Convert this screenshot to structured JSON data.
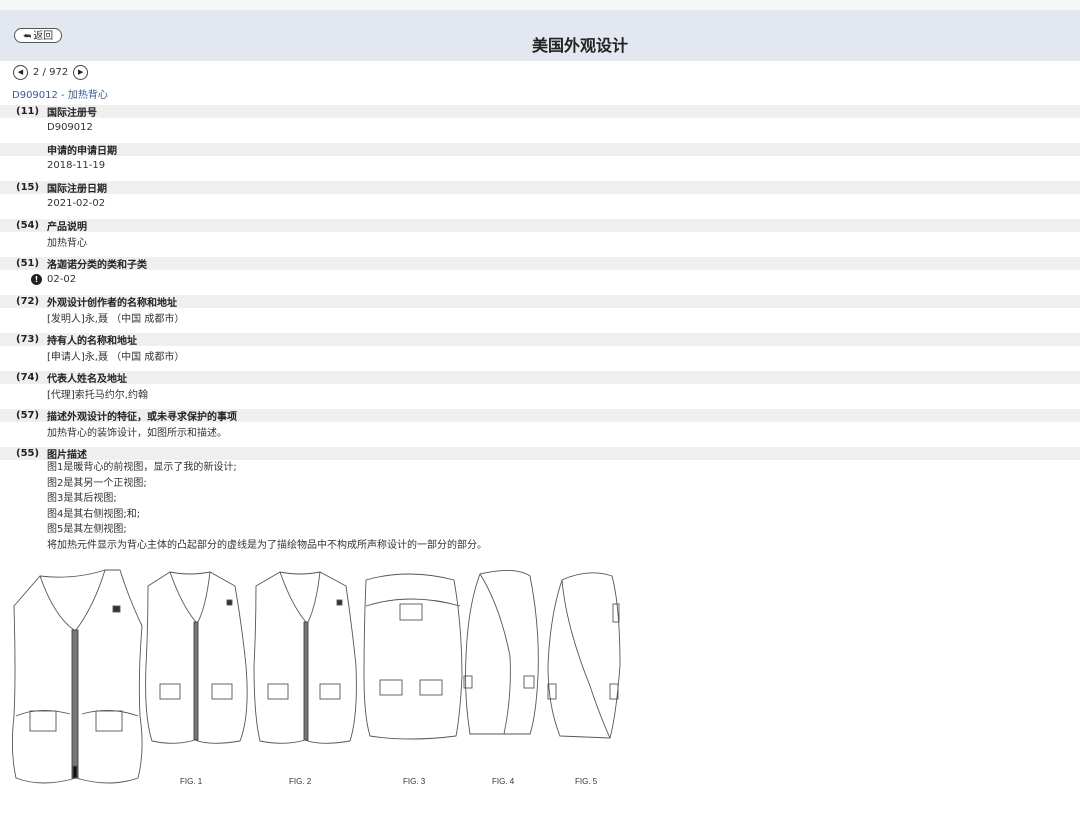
{
  "header": {
    "back_label": "返回",
    "title": "美国外观设计"
  },
  "pager": {
    "prev_icon": "chevron-left-icon",
    "current": "2 / 972",
    "next_icon": "chevron-right-icon"
  },
  "record_title": "D909012 - 加热背心",
  "fields": [
    {
      "code": "(11)",
      "label": "国际注册号",
      "value": "D909012"
    },
    {
      "code": "",
      "label": "申请的申请日期",
      "value": "2018-11-19"
    },
    {
      "code": "(15)",
      "label": "国际注册日期",
      "value": "2021-02-02"
    },
    {
      "code": "(54)",
      "label": "产品说明",
      "value": "加热背心"
    },
    {
      "code": "(51)",
      "label": "洛迦诺分类的类和子类",
      "value": "02-02"
    },
    {
      "code": "(72)",
      "label": "外观设计创作者的名称和地址",
      "value": "[发明人]永,聂 （中国 成都市）"
    },
    {
      "code": "(73)",
      "label": "持有人的名称和地址",
      "value": "[申请人]永,聂 （中国 成都市）"
    },
    {
      "code": "(74)",
      "label": "代表人姓名及地址",
      "value": "[代理]索托马约尔,约翰"
    },
    {
      "code": "(57)",
      "label": "描述外观设计的特征，或未寻求保护的事项",
      "value": "加热背心的装饰设计，如图所示和描述。"
    },
    {
      "code": "(55)",
      "label": "图片描述"
    }
  ],
  "figure_description": [
    "图1是暖背心的前视图，显示了我的新设计;",
    "图2是其另一个正视图;",
    "图3是其后视图;",
    "图4是其右侧视图;和;",
    "图5是其左侧视图;",
    "将加热元件显示为背心主体的凸起部分的虚线是为了描绘物品中不构成所声称设计的一部分的部分。"
  ],
  "figure_labels": [
    "FIG. 1",
    "FIG. 2",
    "FIG. 3",
    "FIG. 4",
    "FIG. 5"
  ],
  "colors": {
    "header_bg": "#e3e7ef",
    "field_head_bg": "#efefef",
    "link": "#3a5a8c"
  },
  "icons": {
    "back": "back-arrow-icon",
    "info": "info-icon"
  }
}
